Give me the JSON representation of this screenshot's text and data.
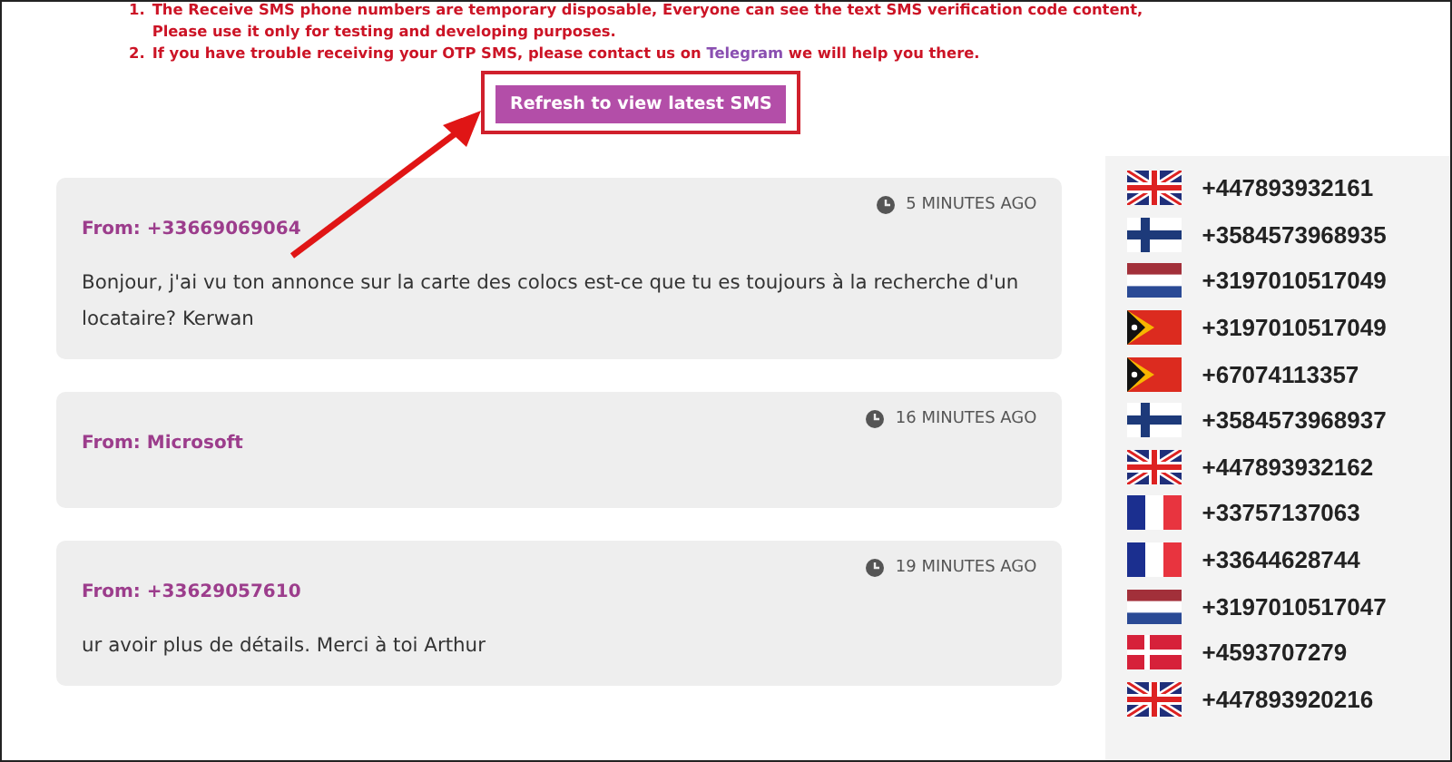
{
  "notices": [
    {
      "number": "1.",
      "text": "The Receive SMS phone numbers are temporary disposable, Everyone can see the text SMS verification code content, Please use it only for testing and developing purposes."
    },
    {
      "number": "2.",
      "text": "If you have trouble receiving your OTP SMS, please contact us on ",
      "link": "Telegram",
      "text_after": " we will help you there."
    }
  ],
  "refresh_button": {
    "label": "Refresh to view latest SMS",
    "highlighted": true
  },
  "annotation_arrow": true,
  "messages": [
    {
      "time": "5 MINUTES AGO",
      "from": "From: +33669069064",
      "body": "Bonjour, j'ai vu ton annonce sur la carte des colocs est-ce que tu es toujours à la recherche d'un locataire? Kerwan"
    },
    {
      "time": "16 MINUTES AGO",
      "from": "From: Microsoft"
    },
    {
      "time": "19 MINUTES AGO",
      "from": "From: +33629057610",
      "body": "ur avoir plus de détails. Merci à toi Arthur"
    }
  ],
  "numbers": [
    {
      "kind": "uk",
      "number": "+447893932161"
    },
    {
      "kind": "fi",
      "number": "+3584573968935"
    },
    {
      "kind": "nl",
      "number": "+3197010517049"
    },
    {
      "kind": "tl",
      "number": "+3197010517049"
    },
    {
      "kind": "tl",
      "number": "+67074113357"
    },
    {
      "kind": "fi",
      "number": "+3584573968937"
    },
    {
      "kind": "uk",
      "number": "+447893932162"
    },
    {
      "kind": "fr",
      "number": "+33757137063"
    },
    {
      "kind": "fr",
      "number": "+33644628744"
    },
    {
      "kind": "nl",
      "number": "+3197010517047"
    },
    {
      "kind": "dk",
      "number": "+4593707279"
    },
    {
      "kind": "uk",
      "number": "+447893920216"
    }
  ]
}
